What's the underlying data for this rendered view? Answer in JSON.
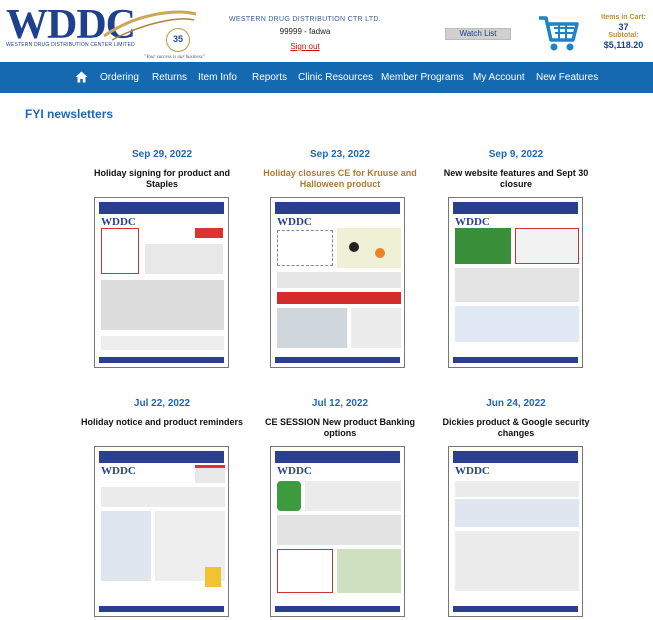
{
  "header": {
    "logo_text": "WDDC",
    "logo_subtitle": "WESTERN DRUG DISTRIBUTION CENTER LIMITED",
    "logo_tagline": "\"Your success is our business\"",
    "logo_seal": "35",
    "company": "WESTERN DRUG DISTRIBUTION CTR LTD.",
    "user": "99999 - fadwa",
    "signout": "Sign out",
    "watch_list": "Watch List",
    "items_label": "Items in Cart:",
    "items_value": "37",
    "subtotal_label": "Subtotal:",
    "subtotal_value": "$5,118.20"
  },
  "nav": {
    "items": [
      "Ordering",
      "Returns",
      "Item Info",
      "Reports",
      "Clinic Resources",
      "Member Programs",
      "My Account",
      "New Features"
    ]
  },
  "page_title": "FYI newsletters",
  "newsletters": [
    {
      "date": "Sep 29, 2022",
      "title": "Holiday signing for product and Staples"
    },
    {
      "date": "Sep 23, 2022",
      "title": "Holiday closures CE for Kruuse and Halloween product"
    },
    {
      "date": "Sep 9, 2022",
      "title": "New website features and Sept 30 closure"
    },
    {
      "date": "Jul 22, 2022",
      "title": "Holiday notice and product reminders"
    },
    {
      "date": "Jul 12, 2022",
      "title": "CE SESSION New product Banking options"
    },
    {
      "date": "Jun 24, 2022",
      "title": "Dickies product & Google security changes"
    }
  ],
  "colors": {
    "brand_blue": "#1f3f8f",
    "nav_blue": "#1469b0",
    "link_blue": "#1f66b4",
    "signout_red": "#cc1111",
    "highlight_title": "#b07a2e"
  },
  "icons": {
    "home": "home-icon",
    "cart": "shopping-cart-icon"
  }
}
